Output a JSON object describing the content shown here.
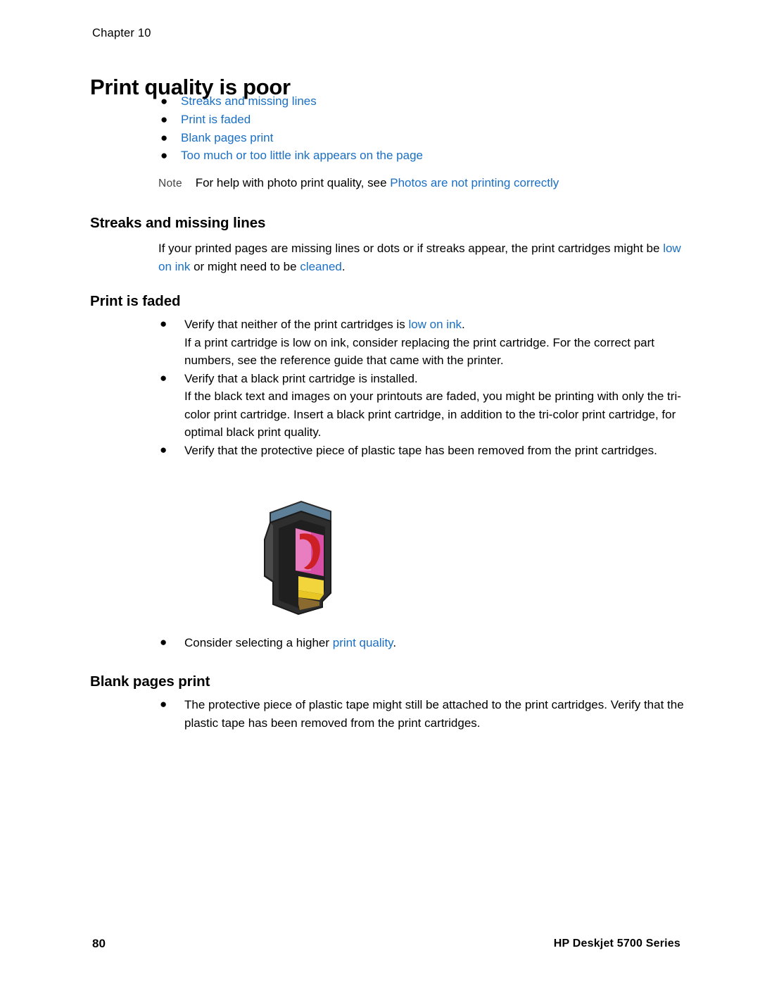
{
  "header": {
    "chapter": "Chapter 10"
  },
  "title": "Print quality is poor",
  "toc_links": [
    "Streaks and missing lines",
    "Print is faded",
    "Blank pages print",
    "Too much or too little ink appears on the page"
  ],
  "note": {
    "label": "Note",
    "text": "For help with photo print quality, see ",
    "link": "Photos are not printing correctly"
  },
  "sections": {
    "streaks": {
      "heading": "Streaks and missing lines",
      "para_part1": "If your printed pages are missing lines or dots or if streaks appear, the print cartridges might be ",
      "link1": "low on ink",
      "para_part2": " or might need to be ",
      "link2": "cleaned",
      "para_part3": "."
    },
    "faded": {
      "heading": "Print is faded",
      "items": [
        {
          "text_before": "Verify that neither of the print cartridges is ",
          "link": "low on ink",
          "text_after": ".",
          "sub": "If a print cartridge is low on ink, consider replacing the print cartridge. For the correct part numbers, see the reference guide that came with the printer."
        },
        {
          "text_before": "Verify that a black print cartridge is installed.",
          "link": "",
          "text_after": "",
          "sub": "If the black text and images on your printouts are faded, you might be printing with only the tri-color print cartridge. Insert a black print cartridge, in addition to the tri-color print cartridge, for optimal black print quality."
        },
        {
          "text_before": "Verify that the protective piece of plastic tape has been removed from the print cartridges.",
          "link": "",
          "text_after": "",
          "sub": ""
        }
      ],
      "last_item": {
        "text_before": "Consider selecting a higher ",
        "link": "print quality",
        "text_after": "."
      },
      "figure_alt": "print-cartridge-illustration"
    },
    "blank": {
      "heading": "Blank pages print",
      "item": "The protective piece of plastic tape might still be attached to the print cartridges. Verify that the plastic tape has been removed from the print cartridges."
    }
  },
  "footer": {
    "page_number": "80",
    "product": "HP Deskjet 5700 Series"
  },
  "colors": {
    "link": "#1a6fc4",
    "text": "#000000"
  }
}
